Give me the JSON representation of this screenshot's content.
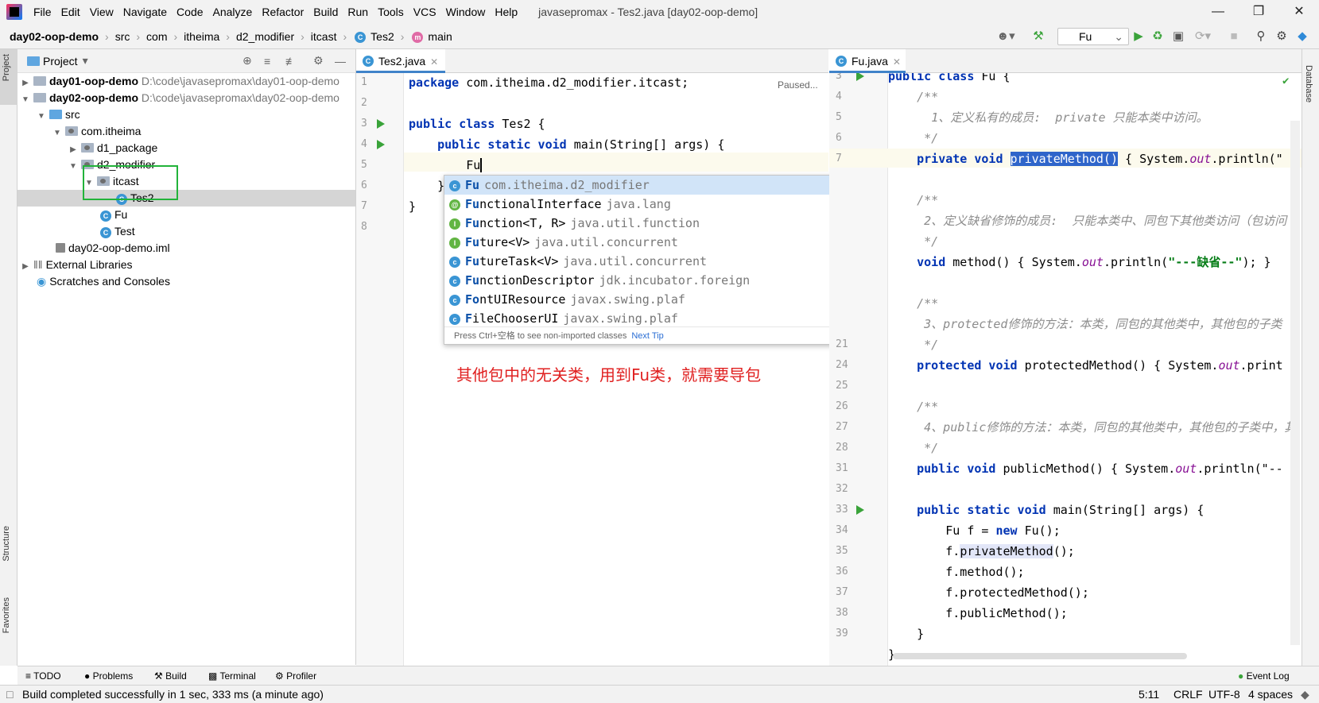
{
  "window": {
    "title": "javasepromax - Tes2.java [day02-oop-demo]",
    "menus": [
      "File",
      "Edit",
      "View",
      "Navigate",
      "Code",
      "Analyze",
      "Refactor",
      "Build",
      "Run",
      "Tools",
      "VCS",
      "Window",
      "Help"
    ]
  },
  "breadcrumb": [
    "day02-oop-demo",
    "src",
    "com",
    "itheima",
    "d2_modifier",
    "itcast",
    "Tes2",
    "main"
  ],
  "toolbar": {
    "run_config": "Fu"
  },
  "side_labels": {
    "project": "Project",
    "structure": "Structure",
    "favorites": "Favorites",
    "database": "Database"
  },
  "project": {
    "header": "Project",
    "tree": [
      {
        "label": "day01-oop-demo",
        "path": "D:\\code\\javasepromax\\day01-oop-demo"
      },
      {
        "label": "day02-oop-demo",
        "path": "D:\\code\\javasepromax\\day02-oop-demo"
      },
      {
        "label": "src"
      },
      {
        "label": "com.itheima"
      },
      {
        "label": "d1_package"
      },
      {
        "label": "d2_modifier"
      },
      {
        "label": "itcast"
      },
      {
        "label": "Tes2"
      },
      {
        "label": "Fu"
      },
      {
        "label": "Test"
      },
      {
        "label": "day02-oop-demo.iml"
      },
      {
        "label": "External Libraries"
      },
      {
        "label": "Scratches and Consoles"
      }
    ]
  },
  "left_editor": {
    "tab": "Tes2.java",
    "status": "Paused...",
    "line_numbers": [
      "1",
      "2",
      "3",
      "4",
      "5",
      "6",
      "7",
      "8"
    ],
    "typed": "Fu"
  },
  "completion": {
    "items": [
      {
        "icon": "c",
        "match": "Fu",
        "rest": "",
        "desc": "com.itheima.d2_modifier"
      },
      {
        "icon": "@",
        "match": "Fu",
        "rest": "nctionalInterface",
        "desc": "java.lang"
      },
      {
        "icon": "I",
        "match": "Fu",
        "rest": "nction<T, R>",
        "desc": "java.util.function"
      },
      {
        "icon": "I",
        "match": "Fu",
        "rest": "ture<V>",
        "desc": "java.util.concurrent"
      },
      {
        "icon": "c",
        "match": "Fu",
        "rest": "tureTask<V>",
        "desc": "java.util.concurrent"
      },
      {
        "icon": "c",
        "match": "Fu",
        "rest": "nctionDescriptor",
        "desc": "jdk.incubator.foreign"
      },
      {
        "icon": "c",
        "match": "Fo",
        "rest": "ntUIResource",
        "desc": "javax.swing.plaf"
      },
      {
        "icon": "c",
        "match": "F",
        "rest": "ileChooserUI",
        "desc": "javax.swing.plaf"
      }
    ],
    "footer": "Press Ctrl+空格 to see non-imported classes",
    "tip_link": "Next Tip"
  },
  "annotation": "其他包中的无关类，用到Fu类，就需要导包",
  "right_editor": {
    "tab": "Fu.java",
    "line_numbers": [
      "3",
      "4",
      "5",
      "6",
      "7",
      "",
      "",
      "",
      "",
      "",
      "",
      "",
      "",
      "",
      "21",
      "24",
      "25",
      "26",
      "27",
      "28",
      "31",
      "32",
      "33",
      "34",
      "35",
      "36",
      "37",
      "38",
      "39"
    ],
    "comments": {
      "c1": "1、定义私有的成员:  private 只能本类中访问。",
      "c2": "2、定义缺省修饰的成员:  只能本类中、同包下其他类访问（包访问",
      "c3": "3、protected修饰的方法：本类，同包的其他类中，其他包的子类",
      "c4": "4、public修饰的方法：本类，同包的其他类中，其他包的子类中，其"
    },
    "strings": {
      "s1": "\"---缺省--\""
    }
  },
  "tool_windows": [
    "TODO",
    "Problems",
    "Build",
    "Terminal",
    "Profiler"
  ],
  "event_log": "Event Log",
  "status": {
    "message": "Build completed successfully in 1 sec, 333 ms (a minute ago)",
    "position": "5:11",
    "line_sep": "CRLF",
    "encoding": "UTF-8",
    "indent": "4 spaces"
  }
}
